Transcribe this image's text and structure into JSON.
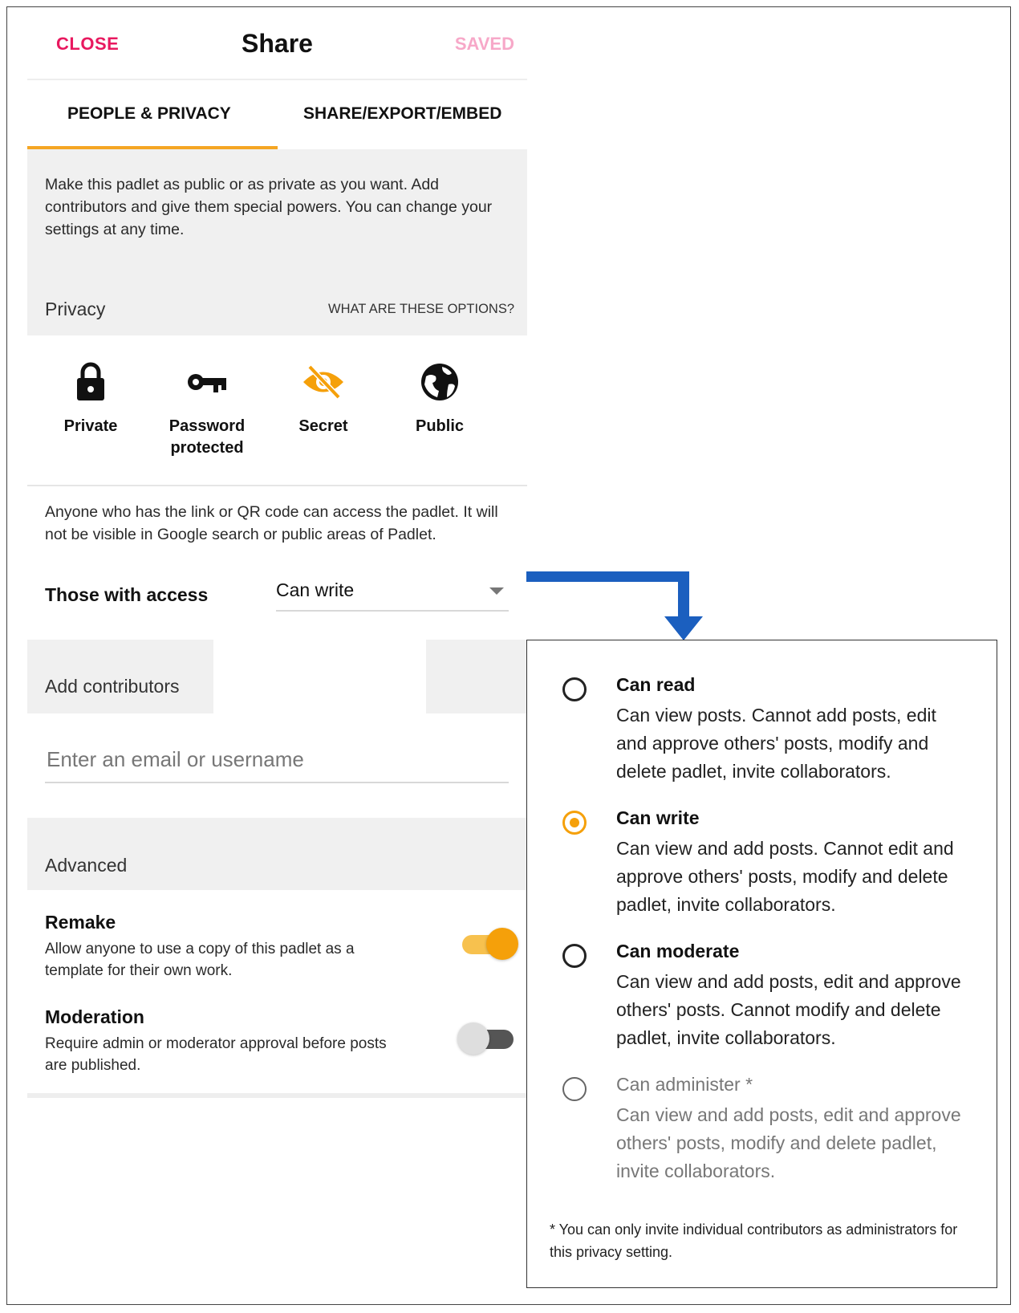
{
  "header": {
    "close_label": "CLOSE",
    "title": "Share",
    "status_label": "SAVED"
  },
  "tabs": [
    {
      "label": "PEOPLE & PRIVACY",
      "active": true
    },
    {
      "label": "SHARE/EXPORT/EMBED",
      "active": false
    }
  ],
  "intro_text": "Make this padlet as public or as private as you want. Add contributors and give them special powers. You can change your settings at any time.",
  "privacy": {
    "section_label": "Privacy",
    "help_link": "WHAT ARE THESE OPTIONS?",
    "options": [
      {
        "label": "Private",
        "icon": "lock-icon",
        "selected": false
      },
      {
        "label": "Password protected",
        "icon": "key-icon",
        "selected": false
      },
      {
        "label": "Secret",
        "icon": "eye-slash-icon",
        "selected": true
      },
      {
        "label": "Public",
        "icon": "globe-icon",
        "selected": false
      }
    ],
    "selected_description": "Anyone who has the link or QR code can access the padlet. It will not be visible in Google search or public areas of Padlet."
  },
  "access": {
    "label": "Those with access",
    "value": "Can write"
  },
  "contributors": {
    "section_label": "Add contributors",
    "placeholder": "Enter an email or username"
  },
  "advanced": {
    "section_label": "Advanced",
    "settings": [
      {
        "title": "Remake",
        "description": "Allow anyone to use a copy of this padlet as a template for their own work.",
        "enabled": true
      },
      {
        "title": "Moderation",
        "description": "Require admin or moderator approval before posts are published.",
        "enabled": false
      }
    ]
  },
  "access_menu": {
    "options": [
      {
        "title": "Can read",
        "description": "Can view posts. Cannot add posts, edit and approve others' posts, modify and delete padlet, invite collaborators.",
        "selected": false,
        "disabled": false
      },
      {
        "title": "Can write",
        "description": "Can view and add posts. Cannot edit and approve others' posts, modify and delete padlet, invite collaborators.",
        "selected": true,
        "disabled": false
      },
      {
        "title": "Can moderate",
        "description": "Can view and add posts, edit and approve others' posts. Cannot modify and delete padlet, invite collaborators.",
        "selected": false,
        "disabled": false
      },
      {
        "title": "Can administer *",
        "description": "Can view and add posts, edit and approve others' posts, modify and delete padlet, invite collaborators.",
        "selected": false,
        "disabled": true
      }
    ],
    "footnote": "* You can only invite individual contributors as administrators for this privacy setting."
  },
  "colors": {
    "accent": "#f5a00a",
    "close": "#e8195f",
    "saved": "#f7a8c8",
    "arrow": "#1b5fbf"
  }
}
